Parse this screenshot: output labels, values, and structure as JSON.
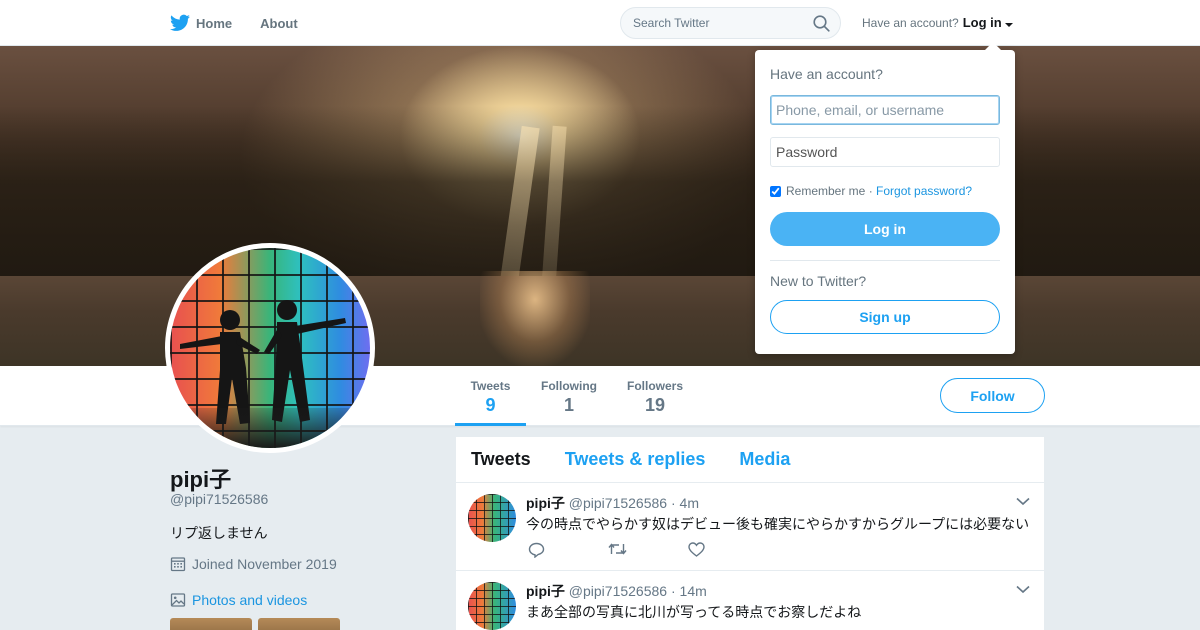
{
  "nav": {
    "home_label": "Home",
    "about_label": "About",
    "search_placeholder": "Search Twitter",
    "have_account": "Have an account?",
    "login_label": "Log in"
  },
  "profile_nav": {
    "stats": [
      {
        "label": "Tweets",
        "value": "9"
      },
      {
        "label": "Following",
        "value": "1"
      },
      {
        "label": "Followers",
        "value": "19"
      }
    ],
    "follow_label": "Follow"
  },
  "profile": {
    "name": "pipi子",
    "handle": "@pipi71526586",
    "bio": "リプ返しません",
    "joined": "Joined November 2019",
    "photos_label": "Photos and videos"
  },
  "timeline": {
    "tabs": [
      "Tweets",
      "Tweets & replies",
      "Media"
    ],
    "tweets": [
      {
        "name": "pipi子",
        "handle": "@pipi71526586",
        "time": "4m",
        "text": "今の時点でやらかす奴はデビュー後も確実にやらかすからグループには必要ない"
      },
      {
        "name": "pipi子",
        "handle": "@pipi71526586",
        "time": "14m",
        "text": "まあ全部の写真に北川が写ってる時点でお察しだよね"
      }
    ]
  },
  "login_dropdown": {
    "title": "Have an account?",
    "username_placeholder": "Phone, email, or username",
    "password_placeholder": "Password",
    "remember_label": "Remember me",
    "separator": " · ",
    "forgot_label": "Forgot password?",
    "login_button": "Log in",
    "new_label": "New to Twitter?",
    "signup_button": "Sign up"
  },
  "colors": {
    "brand": "#1da1f2",
    "background": "#e6ecf0",
    "text_secondary": "#657786"
  }
}
